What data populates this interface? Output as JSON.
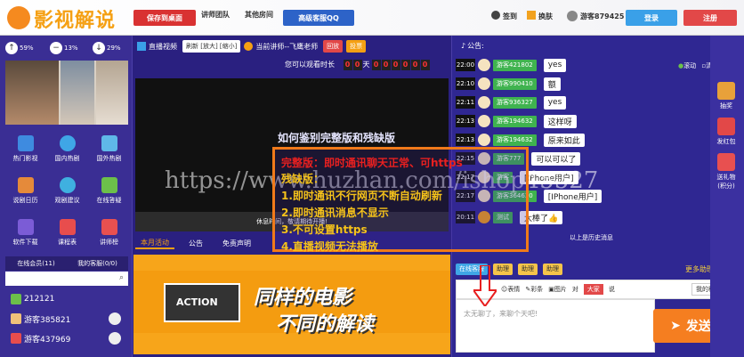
{
  "header": {
    "logo_text": "影视解说",
    "btn_desktop": "保存到桌面",
    "btn_teachers": "讲师团队",
    "btn_rooms": "其他房间",
    "btn_qq": "高级客服QQ",
    "signin": "签到",
    "skin": "换肤",
    "username": "游客879425",
    "login": "登录",
    "register": "注册"
  },
  "stats": [
    {
      "arrow": "↑",
      "value": "59%"
    },
    {
      "arrow": "−",
      "value": "13%"
    },
    {
      "arrow": "↓",
      "value": "29%"
    }
  ],
  "grid": [
    {
      "label": "热门影视",
      "color": "#3e8be0"
    },
    {
      "label": "国内热剧",
      "color": "#3fa6e6"
    },
    {
      "label": "国外热剧",
      "color": "#5fb8e8"
    },
    {
      "label": "说剧日历",
      "color": "#e58a3a"
    },
    {
      "label": "观剧建议",
      "color": "#3fb0e0"
    },
    {
      "label": "在线答疑",
      "color": "#6cc04a"
    },
    {
      "label": "软件下载",
      "color": "#7b5cd6"
    },
    {
      "label": "课程表",
      "color": "#e84d4d"
    },
    {
      "label": "讲师榜",
      "color": "#e85050"
    }
  ],
  "online": {
    "tab_members": "在线会员(11)",
    "tab_service": "我的客服(0/0)",
    "users": [
      "212121",
      "游客385821",
      "游客437969"
    ]
  },
  "mid": {
    "live_label": "直播视频",
    "refresh": "刷新 [放大] [缩小]",
    "current_teacher": "当前讲师--飞鹰老师",
    "replay": "回放",
    "vote": "投票",
    "watch_time_label": "您可以观看时长",
    "timer_digits": [
      "0",
      "0",
      "天",
      "0",
      "0",
      "0",
      "0",
      "0",
      "0"
    ],
    "video_notice": "休息时间，敬请期待开播!",
    "tabs": [
      "本月活动",
      "公告",
      "免责声明"
    ],
    "banner_line1": "同样的电影",
    "banner_line2": "不同的解读",
    "clapper": "ACTION"
  },
  "chat": {
    "notice": "公告:",
    "roll": "滚动",
    "clear": "清屏",
    "messages": [
      {
        "time": "22:00",
        "name": "游客421802",
        "msg": "yes"
      },
      {
        "time": "22:10",
        "name": "游客990410",
        "msg": "额"
      },
      {
        "time": "22:11",
        "name": "游客936327",
        "msg": "yes"
      },
      {
        "time": "22:13",
        "name": "游客194632",
        "msg": "这样呀"
      },
      {
        "time": "22:13",
        "name": "游客194632",
        "msg": "原来如此"
      },
      {
        "time": "22:15",
        "name": "游客777",
        "msg": "可以可以了"
      },
      {
        "time": "22:17",
        "name": "游客",
        "msg": "[IPhone用户]"
      },
      {
        "time": "22:17",
        "name": "游客364630",
        "msg": "[IPhone用户]"
      },
      {
        "time": "20:11",
        "name": "测试",
        "msg": "太棒了👍"
      }
    ],
    "history": "以上是历史消息",
    "room_tab": "在线客服",
    "assistants": [
      "助理",
      "助理",
      "助理"
    ],
    "more_assist": "更多助理>>",
    "tool_emoji": "表情",
    "tool_color": "彩条",
    "tool_image": "图片",
    "to_label": "对",
    "to_target": "大家",
    "say_label": "说",
    "private": "我的私聊",
    "input_placeholder": "太无聊了，来聊个天吧!",
    "send": "发送"
  },
  "sidebar": {
    "items": [
      "抽奖",
      "发红包",
      "送礼物",
      "(积分)"
    ]
  },
  "overlay": {
    "watermark": "https://www.huzhan.com/ishop45527",
    "title": "如何鉴别完整版和残缺版",
    "full_version": "完整版：即时通讯聊天正常、可https",
    "broken_label": "残缺版：",
    "lines": [
      "1.即时通讯不行网页不断自动刷新",
      "2.即时通讯消息不显示",
      "3.不可设置https",
      "4.直播视频无法播放"
    ]
  }
}
